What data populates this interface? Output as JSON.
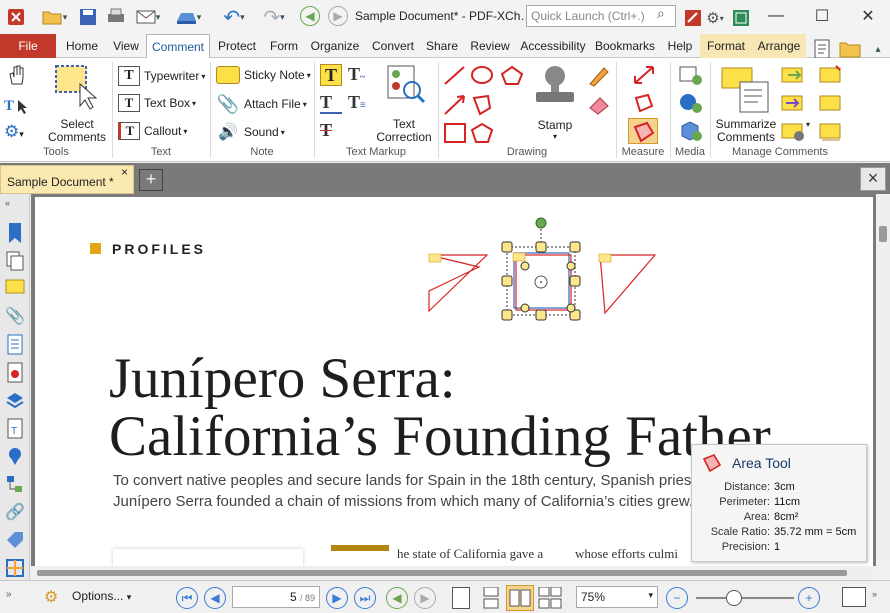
{
  "window": {
    "title": "Sample Document* - PDF-XCh…",
    "quick_launch_placeholder": "Quick Launch (Ctrl+.)"
  },
  "ribbon_tabs": [
    "File",
    "Home",
    "View",
    "Comment",
    "Protect",
    "Form",
    "Organize",
    "Convert",
    "Share",
    "Review",
    "Accessibility",
    "Bookmarks",
    "Help",
    "Format",
    "Arrange"
  ],
  "groups": {
    "tools": {
      "label": "Tools",
      "select_comments": "Select\nComments",
      "select_line1": "Select",
      "select_line2": "Comments"
    },
    "text": {
      "label": "Text",
      "typewriter": "Typewriter",
      "text_box": "Text Box",
      "callout": "Callout"
    },
    "note": {
      "label": "Note",
      "sticky_note": "Sticky Note",
      "attach_file": "Attach File",
      "sound": "Sound"
    },
    "text_markup": {
      "label": "Text Markup",
      "text_correction_1": "Text",
      "text_correction_2": "Correction"
    },
    "drawing": {
      "label": "Drawing",
      "stamp": "Stamp"
    },
    "measure": {
      "label": "Measure"
    },
    "media": {
      "label": "Media"
    },
    "manage": {
      "label": "Manage Comments",
      "summarize_1": "Summarize",
      "summarize_2": "Comments"
    }
  },
  "doc_tab": {
    "label": "Sample Document *",
    "close": "×",
    "new": "+"
  },
  "page": {
    "section": "PROFILES",
    "headline_1": "Junípero Serra:",
    "headline_2": "California’s Founding Father",
    "intro_1": "To convert native peoples and secure lands for Spain in the 18th century, Spanish priest",
    "intro_2": "Junípero Serra founded a chain of missions from which many of California’s cities grew.",
    "body_1": "he state of California gave a",
    "body_2": "whose efforts culmi"
  },
  "tooltip": {
    "title": "Area Tool",
    "rows": [
      {
        "k": "Distance:",
        "v": "3cm"
      },
      {
        "k": "Perimeter:",
        "v": "11cm"
      },
      {
        "k": "Area:",
        "v": "8cm²"
      },
      {
        "k": "Scale Ratio:",
        "v": "35.72 mm = 5cm"
      },
      {
        "k": "Precision:",
        "v": "1"
      }
    ]
  },
  "status": {
    "options": "Options...",
    "page_current": "5",
    "page_total": "/ 89",
    "zoom": "75%"
  },
  "colors": {
    "accent": "#c0392b",
    "tab_active": "#1a5a9a",
    "format_tab": "#f6e7b4",
    "measure_red": "#d82323"
  }
}
